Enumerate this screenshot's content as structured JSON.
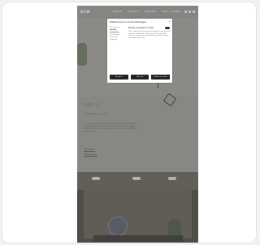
{
  "site": {
    "logo": "DCW",
    "nav": [
      "Products",
      "Collections",
      "Inspiration",
      "About",
      "Contact"
    ]
  },
  "product": {
    "name": "VEX 1",
    "subtitle": "Pendant lamp / wall",
    "description": "Lorem ipsum dolor sit amet, consectetur adipiscing elit, sed do eiusmod tempor incididunt ut labore et dolore magna aliqua. Ut enim ad minim veniam, quis nostrud exercitation ullamco laboris.",
    "link1": "See details",
    "link2": "See designer"
  },
  "cookie_modal": {
    "title": "Preferences & Consent Manager",
    "close": "×",
    "categories": [
      "Your privacy",
      "Strictly necessary",
      "Performance",
      "Functional",
      "Targeting"
    ],
    "active_category": "Strictly necessary",
    "section_title": "Strictly necessary cookies",
    "section_text": "These cookies are necessary for the website to function and cannot be switched off in our systems. They are usually only set in response to actions made by you which amount to a request for services.",
    "buttons": [
      "Accept all",
      "Reject all",
      "Confirm my choices"
    ]
  },
  "colors": {
    "overlay": "#8a8986",
    "accent": "#222222"
  }
}
